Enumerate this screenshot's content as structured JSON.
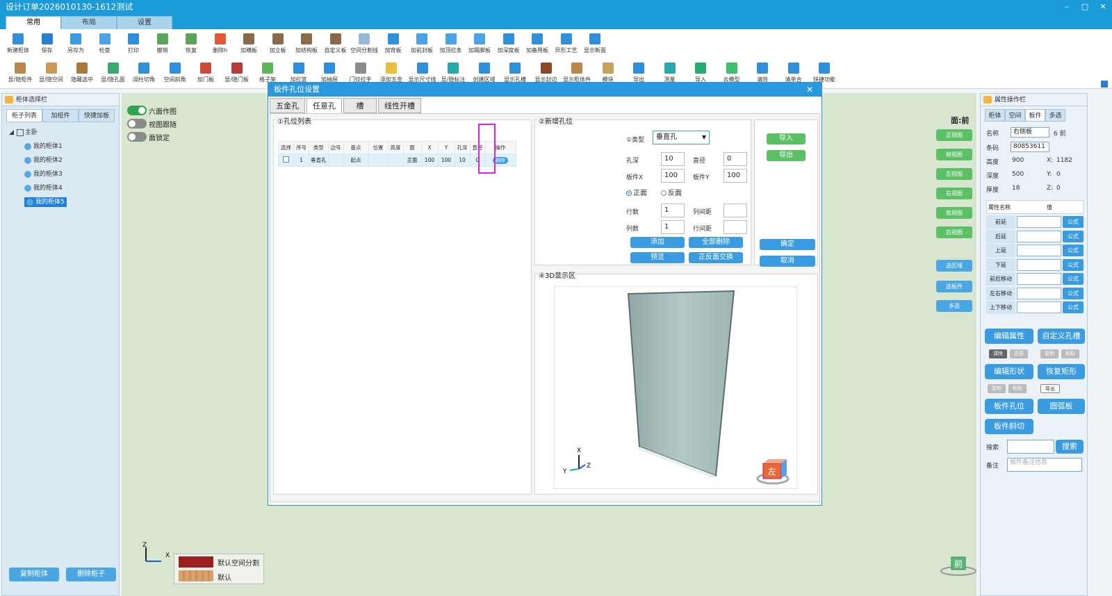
{
  "app": {
    "title": "设计订单2026010130-1612测试",
    "controls": [
      "–",
      "□",
      "✕"
    ]
  },
  "ribbon_tabs": [
    "常用",
    "布局",
    "设置"
  ],
  "toolbar_row1": [
    "新建柜体",
    "保存",
    "另存为",
    "检查",
    "打印",
    "撤销",
    "恢复",
    "删除h",
    "加横板",
    "加立板",
    "加结构板",
    "自定义板",
    "空间分割线",
    "加背板",
    "加前封板",
    "加顶拉条",
    "加踢脚板",
    "加深度板",
    "加备用板",
    "异形工艺",
    "显示断面"
  ],
  "toolbar_row2": [
    "显/隐柜件",
    "显/隐空间",
    "隐藏选中",
    "显/隐孔面",
    "阔柱切角",
    "空间斜角",
    "加门板",
    "显/隐门板",
    "格子架",
    "加拉篮",
    "加抽屉",
    "门铰拉手",
    "添加五金",
    "显示尺寸线",
    "显/隐标注",
    "创建区域",
    "显示孔槽",
    "显示封边",
    "显示柜体件",
    "模块",
    "导出",
    "测量",
    "导入",
    "云模型",
    "清除",
    "清单合",
    "快捷功能"
  ],
  "left_panel": {
    "title": "柜体选择栏",
    "tabs": [
      "柜子列表",
      "加组件",
      "快捷加板"
    ],
    "root": "主卧",
    "items": [
      "我的柜体1",
      "我的柜体2",
      "我的柜体3",
      "我的柜体4",
      "我的柜体5"
    ],
    "buttons": {
      "copy": "复制柜体",
      "delete": "删除柜子"
    }
  },
  "canvas": {
    "toggles": [
      {
        "label": "六面作图",
        "on": true
      },
      {
        "label": "视图跟随",
        "on": false
      },
      {
        "label": "面锁定",
        "on": false
      }
    ],
    "face_label": "面:前",
    "view_buttons": [
      "正视图",
      "俯视图",
      "左视图",
      "右视图",
      "底视图",
      "后视图"
    ],
    "select_buttons": [
      "选区域",
      "选板件",
      "多选"
    ],
    "cube_label": "前",
    "legend": [
      {
        "color": "#9b1f1f",
        "label": "默认空间分割"
      },
      {
        "color": "#d9a26a",
        "label": "默认"
      }
    ],
    "axis": {
      "y": "Z",
      "x": "X"
    }
  },
  "right_panel": {
    "title": "属性操作栏",
    "tabs": [
      "柜体",
      "空间",
      "板件",
      "多选"
    ],
    "name_label": "名称",
    "name_value": "右侧板",
    "name_extra": "6  前",
    "code_label": "条码",
    "code_value": "80853611",
    "height_label": "高度",
    "height_value": "900",
    "x_label": "X:",
    "x_value": "1182",
    "depth_label": "深度",
    "depth_value": "500",
    "y_label": "Y:",
    "y_value": "0",
    "thick_label": "厚度",
    "thick_value": "18",
    "z_label": "Z:",
    "z_value": "0",
    "attr_header": [
      "属性名称",
      "值"
    ],
    "attrs": [
      "前延",
      "后延",
      "上延",
      "下延",
      "前后移动",
      "左右移动",
      "上下移动"
    ],
    "formula_label": "公式",
    "buttons": {
      "edit_attr": "编辑属性",
      "custom_slot": "自定义孔槽",
      "clear": "清除",
      "restore": "还原",
      "copy": "复制",
      "paste": "粘贴",
      "edit_shape": "编辑形状",
      "reset_rect": "恢复矩形",
      "copy2": "复制",
      "paste2": "粘贴",
      "export": "导出",
      "hole": "板件孔位",
      "arc": "圆弧板",
      "bevel": "板件斜切"
    },
    "search_label": "搜索",
    "search_btn": "搜索",
    "note_label": "备注",
    "note_placeholder": "板件备注信息"
  },
  "dialog": {
    "title": "板件孔位设置",
    "close": "✕",
    "tabs": [
      "五金孔",
      "任意孔",
      "槽",
      "线性开槽"
    ],
    "list_title": "①孔位列表",
    "columns": [
      "选择",
      "序号",
      "类型",
      "边号",
      "基点",
      "位置",
      "高度",
      "面",
      "X",
      "Y",
      "孔深",
      "直径",
      "操作"
    ],
    "rows": [
      {
        "no": "1",
        "type": "垂直孔",
        "edge": "",
        "base": "起点",
        "pos": "",
        "height": "",
        "face": "正面",
        "x": "100",
        "y": "100",
        "depth": "10",
        "dia": "0",
        "op": "删除"
      }
    ],
    "new_title": "②新增孔位",
    "type_label": "①类型",
    "type_value": "垂直孔",
    "depth_label": "孔深",
    "depth_value": "10",
    "dia_label": "直径",
    "dia_value": "0",
    "bx_label": "板件X",
    "bx_value": "100",
    "by_label": "板件Y",
    "by_value": "100",
    "face_front": "正面",
    "face_back": "反面",
    "rows_label": "行数",
    "rows_value": "1",
    "colgap_label": "列间距",
    "colgap_value": "",
    "cols_label": "列数",
    "cols_value": "1",
    "rowgap_label": "行间距",
    "rowgap_value": "",
    "btn_add": "添加",
    "btn_delall": "全部删除",
    "btn_preview": "预览",
    "btn_swap": "正反面交换",
    "btn_import": "导入",
    "btn_export": "导出",
    "btn_ok": "确定",
    "btn_cancel": "取消",
    "view_title": "④3D显示区",
    "cube_label": "左",
    "axis": {
      "x": "X",
      "y": "Y",
      "z": "Z"
    }
  }
}
